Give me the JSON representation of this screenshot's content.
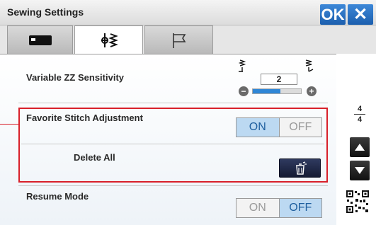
{
  "window": {
    "title": "Sewing Settings"
  },
  "header": {
    "ok_label": "OK",
    "close_glyph": "✕"
  },
  "tabs": [
    {
      "name": "machine-settings",
      "icon": "sewing-machine-icon",
      "active": false
    },
    {
      "name": "stitch-settings",
      "icon": "stitch-icon",
      "active": true
    },
    {
      "name": "embroidery-settings",
      "icon": "flag-icon",
      "active": false
    }
  ],
  "settings": {
    "variable_zz": {
      "label": "Variable ZZ Sensitivity",
      "value": "2",
      "level": 0.57,
      "minus": "−",
      "plus": "+"
    },
    "favorite_stitch": {
      "label": "Favorite Stitch Adjustment",
      "on": "ON",
      "off": "OFF",
      "selected": "ON"
    },
    "delete_all": {
      "label": "Delete All"
    },
    "resume_mode": {
      "label": "Resume Mode",
      "on": "ON",
      "off": "OFF",
      "selected": "OFF"
    }
  },
  "pager": {
    "current": "4",
    "total": "4"
  },
  "colors": {
    "accent": "#1c5fae",
    "highlight": "#d8202a",
    "selected_toggle": "#bcd9f2"
  }
}
